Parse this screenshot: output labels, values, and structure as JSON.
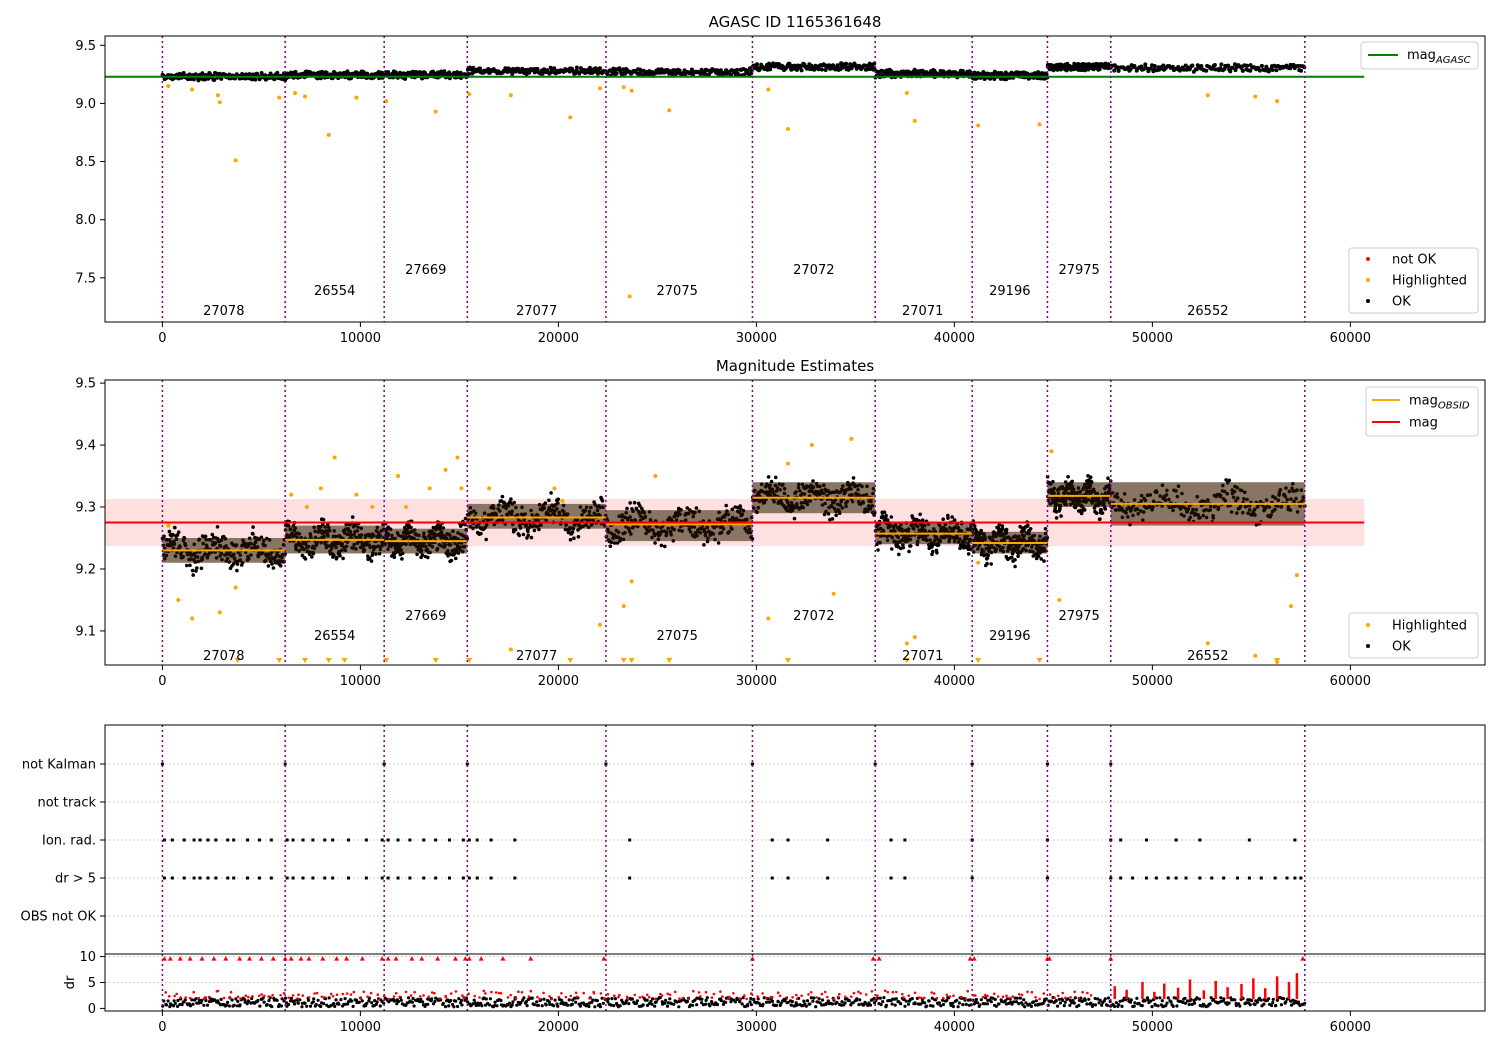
{
  "chart_data": [
    {
      "type": "scatter",
      "title": "AGASC ID 1165361648",
      "xlim": [
        -2900,
        66800
      ],
      "ylim": [
        7.12,
        9.58
      ],
      "xticks": [
        0,
        10000,
        20000,
        30000,
        40000,
        50000,
        60000
      ],
      "xtick_labels": [
        "0",
        "10000",
        "20000",
        "30000",
        "40000",
        "50000",
        "60000"
      ],
      "yticks": [
        7.5,
        8.0,
        8.5,
        9.0,
        9.5
      ],
      "ytick_labels": [
        "7.5",
        "8.0",
        "8.5",
        "9.0",
        "9.5"
      ],
      "obsid_boundaries": [
        0,
        6200,
        11200,
        15400,
        22400,
        29800,
        36000,
        40900,
        44700,
        47900,
        57700
      ],
      "obsids": [
        {
          "label": "27078",
          "x": 3100,
          "y": 7.22
        },
        {
          "label": "26554",
          "x": 8700,
          "y": 7.39
        },
        {
          "label": "27669",
          "x": 13300,
          "y": 7.57
        },
        {
          "label": "27077",
          "x": 18900,
          "y": 7.22
        },
        {
          "label": "27075",
          "x": 26000,
          "y": 7.39
        },
        {
          "label": "27072",
          "x": 32900,
          "y": 7.57
        },
        {
          "label": "27071",
          "x": 38400,
          "y": 7.22
        },
        {
          "label": "29196",
          "x": 42800,
          "y": 7.39
        },
        {
          "label": "27975",
          "x": 46300,
          "y": 7.57
        },
        {
          "label": "26552",
          "x": 52800,
          "y": 7.22
        }
      ],
      "reference_line": {
        "name": "mag_AGASC",
        "value": 9.23,
        "x_range": [
          -2900,
          60700
        ],
        "color": "#008000"
      },
      "segments": [
        {
          "x": [
            0,
            6200
          ],
          "mag": 9.23
        },
        {
          "x": [
            6200,
            11200
          ],
          "mag": 9.245
        },
        {
          "x": [
            11200,
            15400
          ],
          "mag": 9.245
        },
        {
          "x": [
            15400,
            22400
          ],
          "mag": 9.28
        },
        {
          "x": [
            22400,
            29800
          ],
          "mag": 9.27
        },
        {
          "x": [
            29800,
            36000
          ],
          "mag": 9.315
        },
        {
          "x": [
            36000,
            40900
          ],
          "mag": 9.255
        },
        {
          "x": [
            40900,
            44700
          ],
          "mag": 9.24
        },
        {
          "x": [
            44700,
            47900
          ],
          "mag": 9.315
        },
        {
          "x": [
            47900,
            57700
          ],
          "mag": 9.305
        }
      ],
      "highlighted_points": [
        [
          300,
          9.15
        ],
        [
          1500,
          9.12
        ],
        [
          2800,
          9.07
        ],
        [
          2900,
          9.01
        ],
        [
          3700,
          8.51
        ],
        [
          5900,
          9.05
        ],
        [
          6700,
          9.09
        ],
        [
          7200,
          9.06
        ],
        [
          8400,
          8.73
        ],
        [
          9800,
          9.05
        ],
        [
          11300,
          9.02
        ],
        [
          13800,
          8.93
        ],
        [
          15500,
          9.08
        ],
        [
          17600,
          9.07
        ],
        [
          20600,
          8.88
        ],
        [
          22100,
          9.13
        ],
        [
          23300,
          9.14
        ],
        [
          23700,
          9.11
        ],
        [
          23600,
          7.34
        ],
        [
          25600,
          8.94
        ],
        [
          30600,
          9.12
        ],
        [
          31600,
          8.78
        ],
        [
          37600,
          9.09
        ],
        [
          38000,
          8.85
        ],
        [
          41200,
          8.81
        ],
        [
          44300,
          8.82
        ],
        [
          52800,
          9.07
        ],
        [
          55200,
          9.06
        ],
        [
          56300,
          9.02
        ]
      ],
      "band_spread": 0.05,
      "legend_lines": [
        {
          "label": "mag",
          "sub": "AGASC",
          "color": "#008000"
        }
      ],
      "legend_points": [
        {
          "label": "not OK",
          "color": "#ff0000"
        },
        {
          "label": "Highlighted",
          "color": "#ffa500"
        },
        {
          "label": "OK",
          "color": "#000000"
        }
      ]
    },
    {
      "type": "scatter",
      "title": "Magnitude Estimates",
      "xlim": [
        -2900,
        66800
      ],
      "ylim": [
        9.045,
        9.505
      ],
      "xticks": [
        0,
        10000,
        20000,
        30000,
        40000,
        50000,
        60000
      ],
      "xtick_labels": [
        "0",
        "10000",
        "20000",
        "30000",
        "40000",
        "50000",
        "60000"
      ],
      "yticks": [
        9.1,
        9.2,
        9.3,
        9.4,
        9.5
      ],
      "ytick_labels": [
        "9.1",
        "9.2",
        "9.3",
        "9.4",
        "9.5"
      ],
      "obsid_boundaries": [
        0,
        6200,
        11200,
        15400,
        22400,
        29800,
        36000,
        40900,
        44700,
        47900,
        57700
      ],
      "obsids": [
        {
          "label": "27078",
          "x": 3100,
          "y": 9.06
        },
        {
          "label": "26554",
          "x": 8700,
          "y": 9.093
        },
        {
          "label": "27669",
          "x": 13300,
          "y": 9.125
        },
        {
          "label": "27077",
          "x": 18900,
          "y": 9.06
        },
        {
          "label": "27075",
          "x": 26000,
          "y": 9.093
        },
        {
          "label": "27072",
          "x": 32900,
          "y": 9.125
        },
        {
          "label": "27071",
          "x": 38400,
          "y": 9.06
        },
        {
          "label": "29196",
          "x": 42800,
          "y": 9.093
        },
        {
          "label": "27975",
          "x": 46300,
          "y": 9.125
        },
        {
          "label": "26552",
          "x": 52800,
          "y": 9.06
        }
      ],
      "reference_line": {
        "name": "mag",
        "value": 9.275,
        "x_range": [
          -2900,
          60700
        ],
        "color": "#ff0000",
        "band": [
          9.237,
          9.313
        ],
        "band_color": "#ffe0e0"
      },
      "segments": [
        {
          "x": [
            0,
            6200
          ],
          "mag": 9.23,
          "lo": 9.21,
          "hi": 9.25
        },
        {
          "x": [
            6200,
            11200
          ],
          "mag": 9.247,
          "lo": 9.225,
          "hi": 9.27
        },
        {
          "x": [
            11200,
            15400
          ],
          "mag": 9.245,
          "lo": 9.225,
          "hi": 9.265
        },
        {
          "x": [
            15400,
            22400
          ],
          "mag": 9.283,
          "lo": 9.265,
          "hi": 9.305
        },
        {
          "x": [
            22400,
            29800
          ],
          "mag": 9.272,
          "lo": 9.245,
          "hi": 9.295
        },
        {
          "x": [
            29800,
            36000
          ],
          "mag": 9.315,
          "lo": 9.29,
          "hi": 9.34
        },
        {
          "x": [
            36000,
            40900
          ],
          "mag": 9.257,
          "lo": 9.24,
          "hi": 9.275
        },
        {
          "x": [
            40900,
            44700
          ],
          "mag": 9.242,
          "lo": 9.225,
          "hi": 9.26
        },
        {
          "x": [
            44700,
            47900
          ],
          "mag": 9.318,
          "lo": 9.3,
          "hi": 9.34
        },
        {
          "x": [
            47900,
            57700
          ],
          "mag": 9.305,
          "lo": 9.27,
          "hi": 9.34
        }
      ],
      "band_spread": 0.03,
      "highlighted_points": [
        [
          300,
          9.27
        ],
        [
          800,
          9.15
        ],
        [
          1500,
          9.12
        ],
        [
          2900,
          9.13
        ],
        [
          3700,
          9.17
        ],
        [
          6500,
          9.32
        ],
        [
          7300,
          9.3
        ],
        [
          8000,
          9.33
        ],
        [
          8700,
          9.38
        ],
        [
          9800,
          9.32
        ],
        [
          10600,
          9.3
        ],
        [
          11900,
          9.35
        ],
        [
          12300,
          9.3
        ],
        [
          13500,
          9.33
        ],
        [
          14300,
          9.36
        ],
        [
          14900,
          9.38
        ],
        [
          15100,
          9.33
        ],
        [
          16500,
          9.33
        ],
        [
          17600,
          9.07
        ],
        [
          19800,
          9.33
        ],
        [
          20200,
          9.31
        ],
        [
          22100,
          9.11
        ],
        [
          23300,
          9.14
        ],
        [
          23700,
          9.18
        ],
        [
          24900,
          9.35
        ],
        [
          30600,
          9.12
        ],
        [
          31600,
          9.37
        ],
        [
          32800,
          9.4
        ],
        [
          33900,
          9.16
        ],
        [
          34800,
          9.41
        ],
        [
          37600,
          9.08
        ],
        [
          38000,
          9.09
        ],
        [
          41200,
          9.21
        ],
        [
          44900,
          9.39
        ],
        [
          45300,
          9.15
        ],
        [
          52800,
          9.08
        ],
        [
          55200,
          9.06
        ],
        [
          56300,
          9.05
        ],
        [
          57000,
          9.14
        ],
        [
          57300,
          9.19
        ]
      ],
      "lower_limit_markers": [
        3800,
        5900,
        7200,
        8400,
        9200,
        11300,
        13800,
        15500,
        20600,
        23300,
        23700,
        25600,
        31600,
        37600,
        41200,
        44300,
        56300
      ],
      "legend_lines": [
        {
          "label": "mag",
          "sub": "OBSID",
          "color": "#ffa500"
        },
        {
          "label": "mag",
          "sub": "",
          "color": "#ff0000"
        }
      ],
      "legend_points": [
        {
          "label": "Highlighted",
          "color": "#ffa500"
        },
        {
          "label": "OK",
          "color": "#000000"
        }
      ]
    },
    {
      "type": "scatter",
      "title": "",
      "xlim": [
        -2900,
        66800
      ],
      "categories": [
        "not Kalman",
        "not track",
        "Ion. rad.",
        "dr > 5",
        "OBS not OK"
      ],
      "obsid_boundaries": [
        0,
        6200,
        11200,
        15400,
        22400,
        29800,
        36000,
        40900,
        44700,
        47900,
        57700
      ],
      "flag_points": {
        "not Kalman": [
          0,
          6200,
          11200,
          15400,
          22400,
          29800,
          36000,
          40900,
          44700,
          47900
        ],
        "Ion. rad.": [
          100,
          500,
          1100,
          1600,
          1900,
          2300,
          2700,
          3300,
          3600,
          4300,
          4900,
          5500,
          6300,
          6600,
          7100,
          7600,
          8200,
          8600,
          9400,
          10300,
          11100,
          11400,
          11900,
          12500,
          13200,
          13800,
          14500,
          15200,
          15500,
          15900,
          16600,
          17800,
          23600,
          30800,
          31600,
          33600,
          36800,
          37500,
          40900,
          44700,
          47900,
          48400,
          49700,
          51200,
          52400,
          54900,
          57200
        ],
        "dr > 5": [
          100,
          500,
          1100,
          1600,
          1900,
          2300,
          2700,
          3300,
          3600,
          4300,
          4900,
          5500,
          6300,
          6600,
          7100,
          7600,
          8200,
          8600,
          9400,
          10300,
          11100,
          11400,
          11900,
          12500,
          13200,
          13800,
          14500,
          15200,
          15500,
          15900,
          16600,
          17800,
          23600,
          30800,
          31600,
          33600,
          36800,
          37500,
          40900,
          44700,
          47900,
          48400,
          49000,
          49700,
          50200,
          50800,
          51200,
          51700,
          52400,
          53000,
          53600,
          54300,
          54900,
          55500,
          56200,
          56800,
          57200,
          57500
        ]
      }
    },
    {
      "type": "scatter",
      "title": "",
      "ylabel": "dr",
      "xlim": [
        -2900,
        66800
      ],
      "ylim": [
        -0.5,
        10.5
      ],
      "xticks": [
        0,
        10000,
        20000,
        30000,
        40000,
        50000,
        60000
      ],
      "xtick_labels": [
        "0",
        "10000",
        "20000",
        "30000",
        "40000",
        "50000",
        "60000"
      ],
      "yticks": [
        0,
        5,
        10
      ],
      "ytick_labels": [
        "0",
        "5",
        "10"
      ],
      "obsid_boundaries": [
        0,
        6200,
        11200,
        15400,
        22400,
        29800,
        36000,
        40900,
        44700,
        47900,
        57700
      ],
      "saturated_markers": [
        100,
        400,
        900,
        1400,
        2000,
        2600,
        3200,
        3900,
        4400,
        5000,
        5600,
        6200,
        6500,
        7000,
        7400,
        8100,
        8800,
        9300,
        10100,
        11100,
        11400,
        11800,
        12600,
        13100,
        13900,
        14800,
        15300,
        15500,
        16100,
        17200,
        18600,
        22300,
        29800,
        35900,
        36200,
        40800,
        41000,
        44700,
        44800,
        47900,
        57600
      ],
      "high_dr_segments": [
        [
          48100,
          4.3
        ],
        [
          48700,
          3.6
        ],
        [
          49500,
          5.1
        ],
        [
          50100,
          3.2
        ],
        [
          50600,
          4.8
        ],
        [
          51300,
          4.0
        ],
        [
          51900,
          5.6
        ],
        [
          52600,
          3.5
        ],
        [
          53200,
          5.3
        ],
        [
          53800,
          4.1
        ],
        [
          54500,
          4.7
        ],
        [
          55100,
          5.8
        ],
        [
          55700,
          3.9
        ],
        [
          56300,
          6.2
        ],
        [
          56900,
          5.1
        ],
        [
          57300,
          6.8
        ]
      ]
    }
  ]
}
